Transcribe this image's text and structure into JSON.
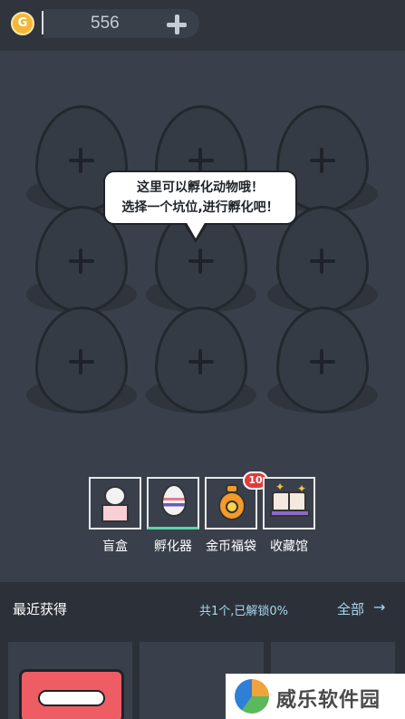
{
  "topbar": {
    "coin_icon": "coin-icon",
    "coin_count": "556",
    "add_icon": "plus-icon"
  },
  "incubator": {
    "slot_count": 9,
    "bubble_line1": "这里可以孵化动物哦！",
    "bubble_line2": "选择一个坑位,进行孵化吧！"
  },
  "tools": [
    {
      "label": "盲盒",
      "icon": "blind-box-icon"
    },
    {
      "label": "孵化器",
      "icon": "incubator-egg-icon",
      "active": true
    },
    {
      "label": "金币福袋",
      "icon": "coin-bag-icon",
      "badge": "10"
    },
    {
      "label": "收藏馆",
      "icon": "collection-book-icon"
    }
  ],
  "recent": {
    "title": "最近获得",
    "unlock_text": "共1个,已解锁0%",
    "all_label": "全部",
    "arrow": "→"
  },
  "watermark": {
    "text": "威乐软件园"
  },
  "colors": {
    "background": "#3a404b",
    "accent": "#5bd5a5",
    "badge": "#e23b3b",
    "link": "#a8d8f0"
  }
}
